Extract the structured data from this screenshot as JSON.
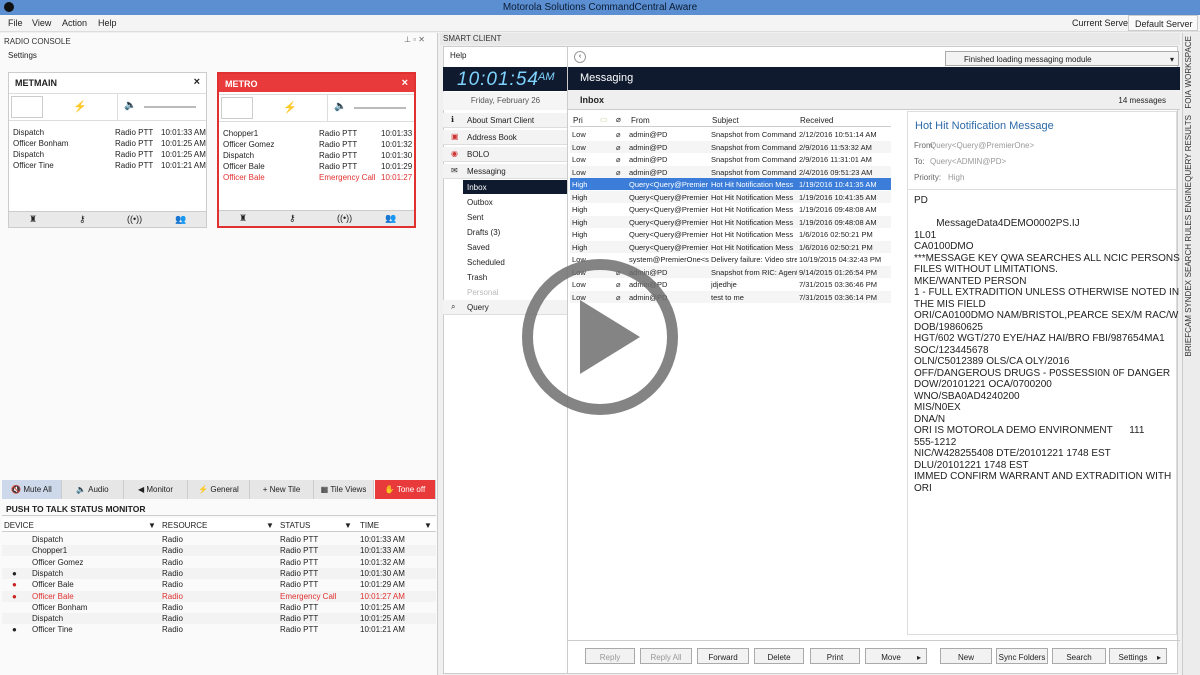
{
  "window": {
    "title": "Motorola Solutions CommandCentral Aware"
  },
  "menu": [
    "File",
    "View",
    "Action",
    "Help"
  ],
  "server": {
    "label": "Current Server:",
    "value": "Default Server"
  },
  "radio_console": {
    "title": "RADIO CONSOLE",
    "settings": "Settings",
    "tiles": [
      {
        "name": "METMAIN",
        "close": "×",
        "rows": [
          [
            "Dispatch",
            "Radio PTT",
            "10:01:33 AM"
          ],
          [
            "Officer Bonham",
            "Radio PTT",
            "10:01:25 AM"
          ],
          [
            "Dispatch",
            "Radio PTT",
            "10:01:25 AM"
          ],
          [
            "Officer Tine",
            "Radio PTT",
            "10:01:21 AM"
          ]
        ]
      },
      {
        "name": "METRO",
        "close": "×",
        "rows": [
          [
            "Chopper1",
            "Radio PTT",
            "10:01:33"
          ],
          [
            "Officer Gomez",
            "Radio PTT",
            "10:01:32"
          ],
          [
            "Dispatch",
            "Radio PTT",
            "10:01:30"
          ],
          [
            "Officer Bale",
            "Radio PTT",
            "10:01:29"
          ],
          [
            "Officer Bale",
            "Emergency Call",
            "10:01:27"
          ]
        ]
      }
    ],
    "toolbar": [
      "Mute All",
      "Audio",
      "Monitor",
      "General",
      "New Tile",
      "Tile Views",
      "Tone off"
    ]
  },
  "ptt": {
    "title": "PUSH TO TALK STATUS MONITOR",
    "columns": [
      "DEVICE",
      "RESOURCE",
      "STATUS",
      "TIME"
    ],
    "rows": [
      [
        "Dispatch",
        "Radio",
        "Radio PTT",
        "10:01:33 AM"
      ],
      [
        "Chopper1",
        "Radio",
        "Radio PTT",
        "10:01:33 AM"
      ],
      [
        "Officer Gomez",
        "Radio",
        "Radio PTT",
        "10:01:32 AM"
      ],
      [
        "Dispatch",
        "Radio",
        "Radio PTT",
        "10:01:30 AM"
      ],
      [
        "Officer Bale",
        "Radio",
        "Radio PTT",
        "10:01:29 AM"
      ],
      [
        "Officer Bale",
        "Radio",
        "Emergency Call",
        "10:01:27 AM"
      ],
      [
        "Officer Bonham",
        "Radio",
        "Radio PTT",
        "10:01:25 AM"
      ],
      [
        "Dispatch",
        "Radio",
        "Radio PTT",
        "10:01:25 AM"
      ],
      [
        "Officer Tine",
        "Radio",
        "Radio PTT",
        "10:01:21 AM"
      ]
    ]
  },
  "smart_client": {
    "tab": "SMART CLIENT",
    "help": "Help",
    "clock": "10:01:54",
    "ampm": "AM",
    "date": "Friday, February 26",
    "nav": [
      "About Smart Client",
      "Address Book",
      "BOLO",
      "Messaging"
    ],
    "folders": [
      "Inbox",
      "Outbox",
      "Sent",
      "Drafts (3)",
      "Saved",
      "Scheduled",
      "Trash",
      "Personal"
    ],
    "query": "Query",
    "status": "Finished loading messaging module",
    "section": "Messaging",
    "inbox_title": "Inbox",
    "inbox_count": "14  messages",
    "columns": [
      "Pri",
      "From",
      "Subject",
      "Received"
    ],
    "messages": [
      [
        "Low",
        "admin@PD",
        "Snapshot from Command",
        "2/12/2016 10:51:14 AM"
      ],
      [
        "Low",
        "admin@PD",
        "Snapshot from Command",
        "2/9/2016 11:53:32 AM"
      ],
      [
        "Low",
        "admin@PD",
        "Snapshot from Command",
        "2/9/2016 11:31:01 AM"
      ],
      [
        "Low",
        "admin@PD",
        "Snapshot from Command",
        "2/4/2016 09:51:23 AM"
      ],
      [
        "High",
        "Query<Query@Premier",
        "Hot Hit Notification Mess",
        "1/19/2016 10:41:35 AM"
      ],
      [
        "High",
        "Query<Query@Premier",
        "Hot Hit Notification Mess",
        "1/19/2016 10:41:35 AM"
      ],
      [
        "High",
        "Query<Query@Premier",
        "Hot Hit Notification Mess",
        "1/19/2016 09:48:08 AM"
      ],
      [
        "High",
        "Query<Query@Premier",
        "Hot Hit Notification Mess",
        "1/19/2016 09:48:08 AM"
      ],
      [
        "High",
        "Query<Query@Premier",
        "Hot Hit Notification Mess",
        "1/6/2016 02:50:21 PM"
      ],
      [
        "High",
        "Query<Query@Premier",
        "Hot Hit Notification Mess",
        "1/6/2016 02:50:21 PM"
      ],
      [
        "Low",
        "system@PremierOne<s",
        "Delivery failure: Video stre",
        "10/19/2015 04:32:43 PM"
      ],
      [
        "Low",
        "admin@PD",
        "Snapshot from RIC: Agent",
        "9/14/2015 01:26:54 PM"
      ],
      [
        "Low",
        "admin@PD",
        "jdjedhje",
        "7/31/2015 03:36:46 PM"
      ],
      [
        "Low",
        "admin@PD",
        "test to me",
        "7/31/2015 03:36:14 PM"
      ]
    ],
    "detail": {
      "title": "Hot Hit Notification Message",
      "from_label": "From:",
      "from": "Query<Query@PremierOne>",
      "to_label": "To:",
      "to": "Query<ADMIN@PD>",
      "priority_label": "Priority:",
      "priority": "High",
      "body": "PD\n\n        MessageData4DEMO0002PS.IJ\n1L01\nCA0100DMO\n***MESSAGE KEY QWA SEARCHES ALL NCIC PERSONS\nFILES WITHOUT LIMITATIONS.\nMKE/WANTED PERSON\n1 - FULL EXTRADITION UNLESS OTHERWISE NOTED IN\nTHE MIS FIELD\nORI/CA0100DMO NAM/BRISTOL,PEARCE SEX/M RAC/W\nDOB/19860625\nHGT/602 WGT/270 EYE/HAZ HAI/BRO FBI/987654MA1\nSOC/123445678\nOLN/C5012389 OLS/CA OLY/2016\nOFF/DANGEROUS DRUGS - P0SSESSI0N 0F DANGER\nDOW/20101221 OCA/0700200\nWNO/SBA0AD4240200\nMIS/N0EX\nDNA/N\nORI IS MOTOROLA DEMO ENVIRONMENT      111\n555-1212\nNIC/W428255408 DTE/20101221 1748 EST\nDLU/20101221 1748 EST\nIMMED CONFIRM WARRANT AND EXTRADITION WITH\nORI"
    },
    "buttons": [
      "Reply",
      "Reply All",
      "Forward",
      "Delete",
      "Print",
      "Move",
      "New",
      "Sync Folders",
      "Search",
      "Settings"
    ]
  },
  "side_tabs": [
    "WORKSPACE",
    "FOIA",
    "QUERY RESULTS",
    "RULES ENGINE",
    "SEARCH",
    "BRIEFCAM SYNDEX"
  ]
}
